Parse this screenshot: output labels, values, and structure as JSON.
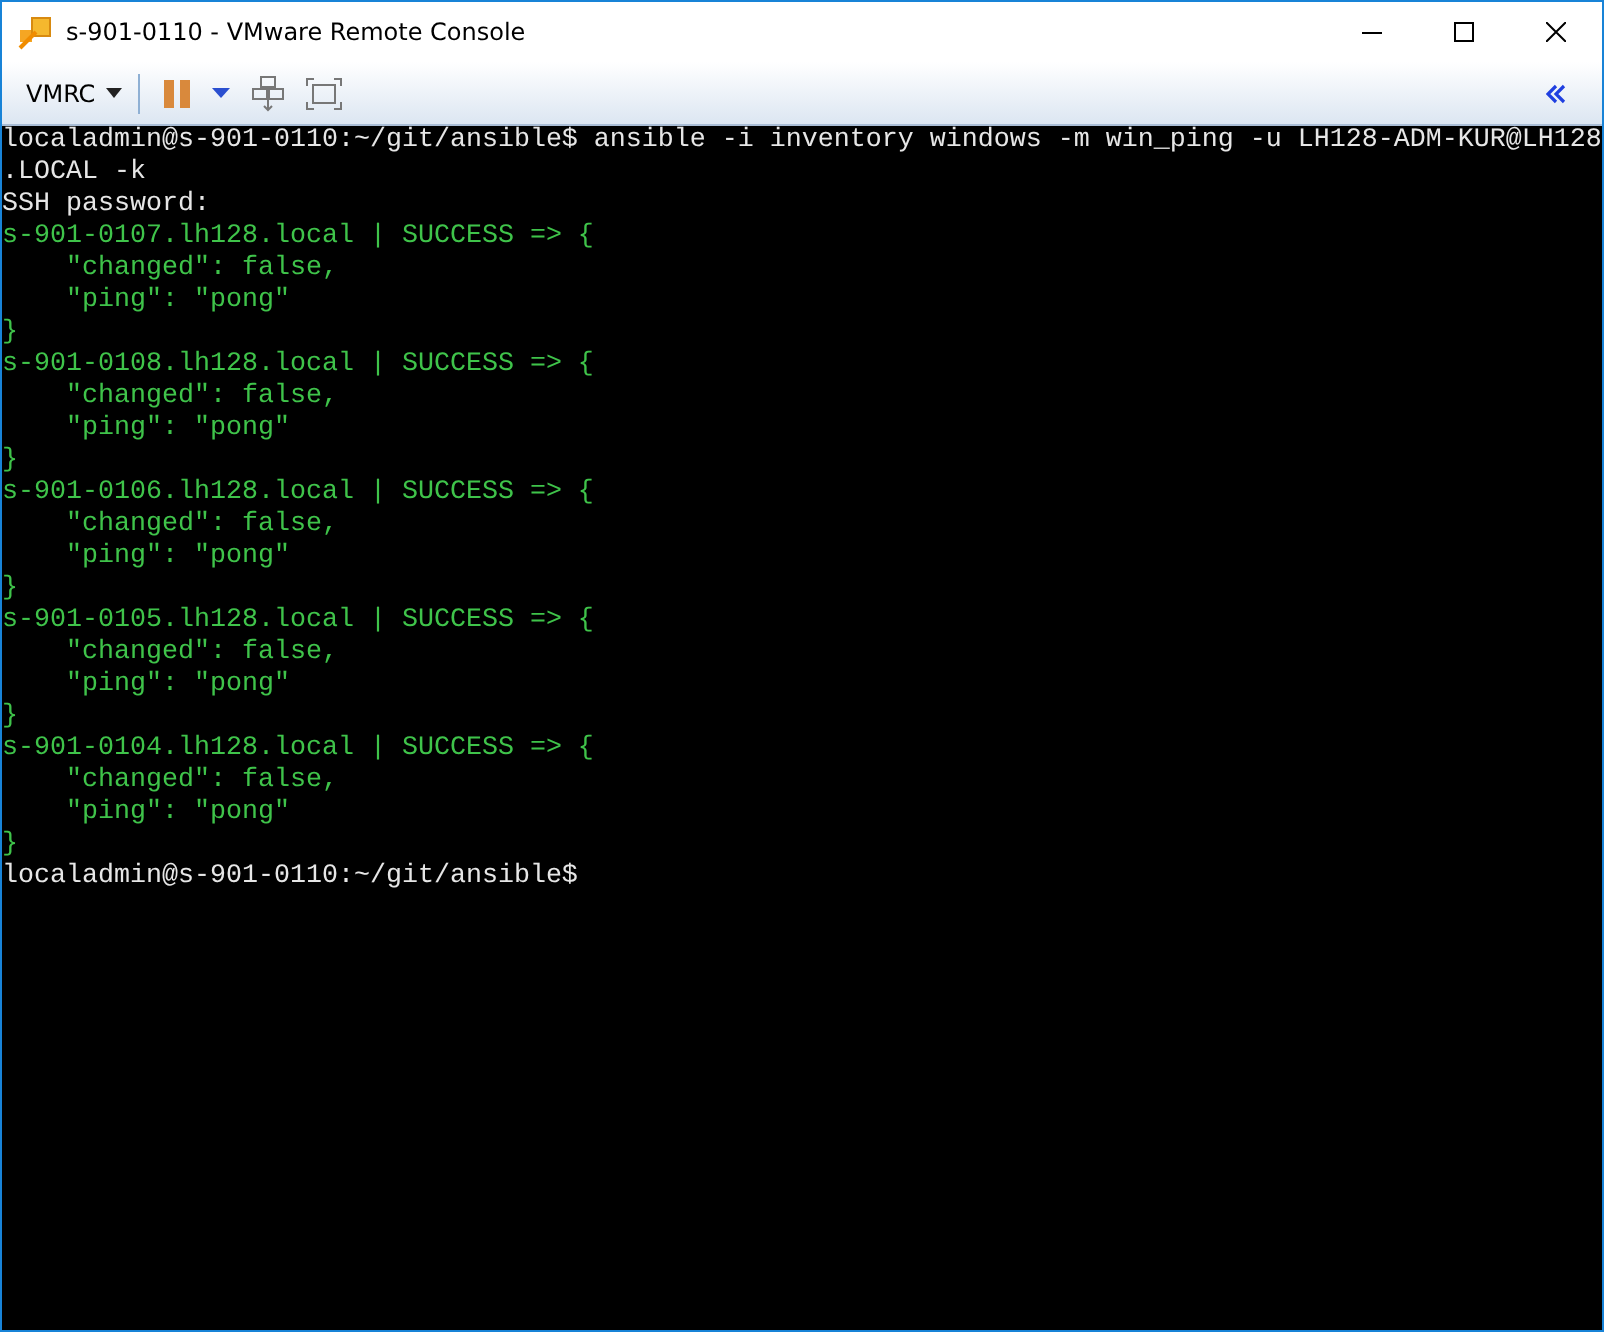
{
  "window": {
    "title": "s-901-0110 - VMware Remote Console"
  },
  "toolbar": {
    "menu_label": "VMRC"
  },
  "terminal": {
    "lines": [
      {
        "kind": "plain",
        "text": "localadmin@s-901-0110:~/git/ansible$ ansible -i inventory windows -m win_ping -u LH128-ADM-KUR@LH128"
      },
      {
        "kind": "plain",
        "text": ".LOCAL -k"
      },
      {
        "kind": "plain",
        "text": "SSH password:"
      },
      {
        "kind": "success",
        "text": "s-901-0107.lh128.local | SUCCESS => {"
      },
      {
        "kind": "success",
        "text": "    \"changed\": false,"
      },
      {
        "kind": "success",
        "text": "    \"ping\": \"pong\""
      },
      {
        "kind": "success",
        "text": "}"
      },
      {
        "kind": "success",
        "text": "s-901-0108.lh128.local | SUCCESS => {"
      },
      {
        "kind": "success",
        "text": "    \"changed\": false,"
      },
      {
        "kind": "success",
        "text": "    \"ping\": \"pong\""
      },
      {
        "kind": "success",
        "text": "}"
      },
      {
        "kind": "success",
        "text": "s-901-0106.lh128.local | SUCCESS => {"
      },
      {
        "kind": "success",
        "text": "    \"changed\": false,"
      },
      {
        "kind": "success",
        "text": "    \"ping\": \"pong\""
      },
      {
        "kind": "success",
        "text": "}"
      },
      {
        "kind": "success",
        "text": "s-901-0105.lh128.local | SUCCESS => {"
      },
      {
        "kind": "success",
        "text": "    \"changed\": false,"
      },
      {
        "kind": "success",
        "text": "    \"ping\": \"pong\""
      },
      {
        "kind": "success",
        "text": "}"
      },
      {
        "kind": "success",
        "text": "s-901-0104.lh128.local | SUCCESS => {"
      },
      {
        "kind": "success",
        "text": "    \"changed\": false,"
      },
      {
        "kind": "success",
        "text": "    \"ping\": \"pong\""
      },
      {
        "kind": "success",
        "text": "}"
      },
      {
        "kind": "plain",
        "text": "localadmin@s-901-0110:~/git/ansible$"
      }
    ]
  }
}
